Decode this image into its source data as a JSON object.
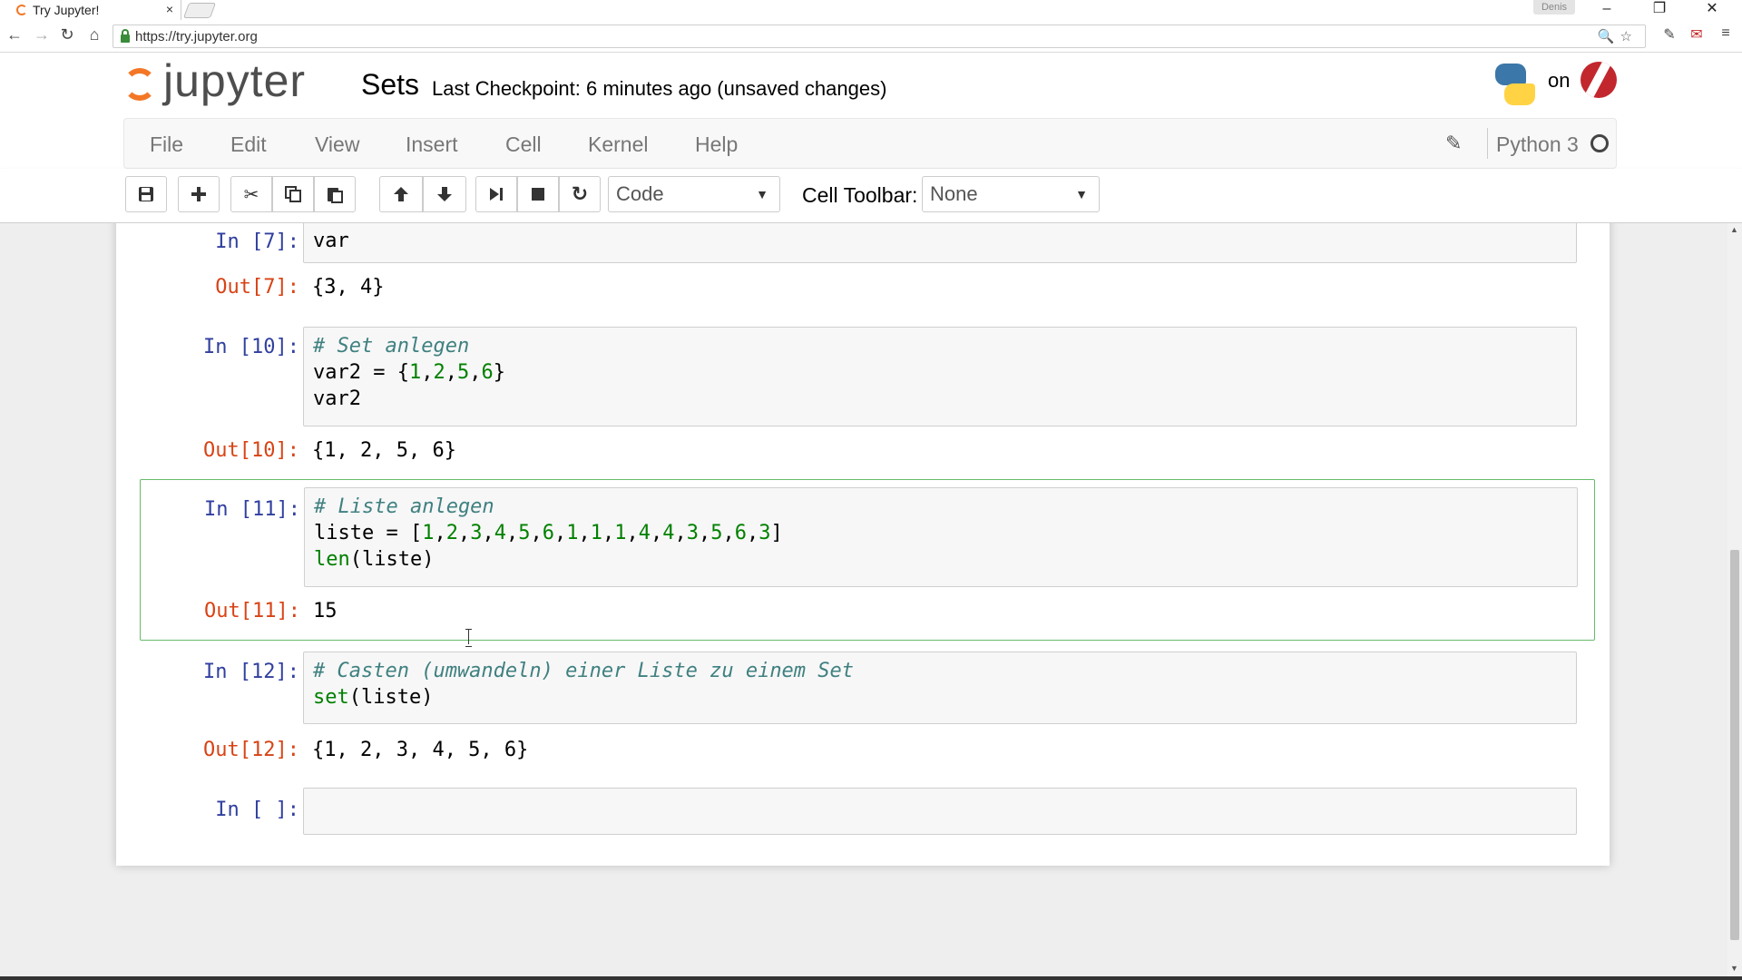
{
  "browser": {
    "tab_title": "Try Jupyter!",
    "tab_close": "×",
    "profile_name": "Denis",
    "url": "https://try.jupyter.org",
    "window_controls": {
      "minimize": "–",
      "maximize": "❐",
      "close": "✕"
    },
    "nav": {
      "back": "←",
      "forward": "→",
      "reload": "↻",
      "home": "⌂"
    },
    "omnibox_icons": "🔍☆"
  },
  "header": {
    "logo_text": "jupyter",
    "notebook_name": "Sets",
    "checkpoint": "Last Checkpoint: 6 minutes ago (unsaved changes)",
    "on_text": "on"
  },
  "menubar": {
    "items": [
      "File",
      "Edit",
      "View",
      "Insert",
      "Cell",
      "Kernel",
      "Help"
    ],
    "kernel_name": "Python 3"
  },
  "toolbar": {
    "cell_type": "Code",
    "cell_toolbar_label": "Cell Toolbar:",
    "cell_toolbar_value": "None",
    "icons": {
      "save": "save-icon",
      "insert": "plus-icon",
      "cut": "scissors-icon",
      "copy": "copy-icon",
      "paste": "paste-icon",
      "move_up": "arrow-up-icon",
      "move_down": "arrow-down-icon",
      "run": "step-forward-icon",
      "stop": "stop-icon",
      "restart": "refresh-icon"
    }
  },
  "cells": [
    {
      "in_prompt": "In [7]:",
      "out_prompt": "Out[7]:",
      "output": "{3, 4}"
    },
    {
      "in_prompt": "In [10]:",
      "out_prompt": "Out[10]:",
      "output": "{1, 2, 5, 6}"
    },
    {
      "in_prompt": "In [11]:",
      "out_prompt": "Out[11]:",
      "output": "15"
    },
    {
      "in_prompt": "In [12]:",
      "out_prompt": "Out[12]:",
      "output": "{1, 2, 3, 4, 5, 6}"
    },
    {
      "in_prompt": "In [ ]:"
    }
  ],
  "code_tokens": {
    "c7": {
      "l1": "var"
    },
    "c10": {
      "comment": "# Set anlegen",
      "l2a": "var2 = {",
      "n1": "1",
      "n2": "2",
      "n5": "5",
      "n6": "6",
      "l2close": "}",
      "comma": ",",
      "l3": "var2"
    },
    "c11": {
      "comment": "# Liste anlegen",
      "l2a": "liste = [",
      "nums": [
        "1",
        "2",
        "3",
        "4",
        "5",
        "6",
        "1",
        "1",
        "1",
        "4",
        "4",
        "3",
        "5",
        "6",
        "3"
      ],
      "l2close": "]",
      "len": "len",
      "l3rest": "(liste)"
    },
    "c12": {
      "comment": "# Casten (umwandeln) einer Liste zu einem Set",
      "set": "set",
      "l2rest": "(liste)"
    }
  },
  "colors": {
    "accent_orange": "#f37726",
    "prompt_in": "#303f9f",
    "prompt_out": "#d84315",
    "selected_border": "#66bb6a",
    "comment": "#408080",
    "number": "#008000"
  }
}
